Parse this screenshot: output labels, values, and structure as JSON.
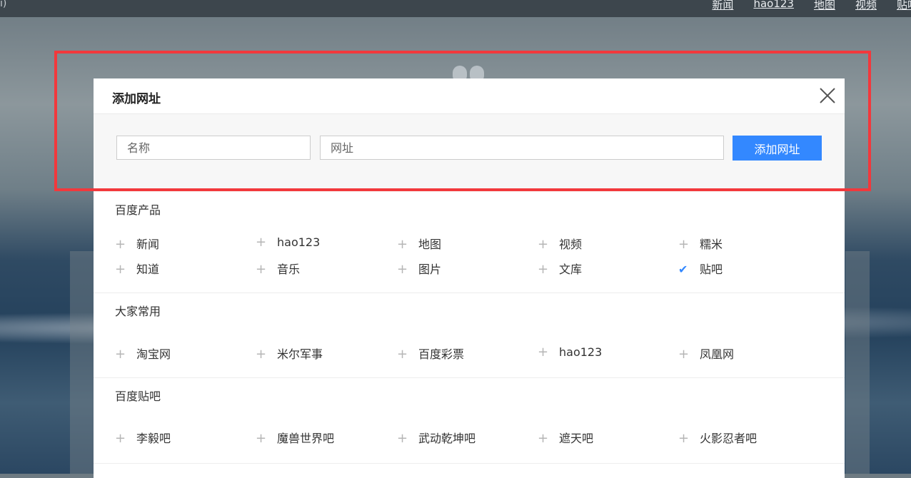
{
  "topbar": {
    "left_glyph": "ı)",
    "nav": [
      "新闻",
      "hao123",
      "地图",
      "视频",
      "贴吧"
    ]
  },
  "modal": {
    "title": "添加网址",
    "name_placeholder": "名称",
    "url_placeholder": "网址",
    "add_button": "添加网址",
    "close_icon": "close-icon"
  },
  "sections": [
    {
      "title": "百度产品",
      "items": [
        {
          "label": "新闻",
          "state": "plus"
        },
        {
          "label": "hao123",
          "state": "plus"
        },
        {
          "label": "地图",
          "state": "plus"
        },
        {
          "label": "视频",
          "state": "plus"
        },
        {
          "label": "糯米",
          "state": "plus"
        },
        {
          "label": "知道",
          "state": "plus"
        },
        {
          "label": "音乐",
          "state": "plus"
        },
        {
          "label": "图片",
          "state": "plus"
        },
        {
          "label": "文库",
          "state": "plus"
        },
        {
          "label": "贴吧",
          "state": "check"
        }
      ]
    },
    {
      "title": "大家常用",
      "items": [
        {
          "label": "淘宝网",
          "state": "plus"
        },
        {
          "label": "米尔军事",
          "state": "plus"
        },
        {
          "label": "百度彩票",
          "state": "plus"
        },
        {
          "label": "hao123",
          "state": "plus"
        },
        {
          "label": "凤凰网",
          "state": "plus"
        }
      ]
    },
    {
      "title": "百度贴吧",
      "items": [
        {
          "label": "李毅吧",
          "state": "plus"
        },
        {
          "label": "魔兽世界吧",
          "state": "plus"
        },
        {
          "label": "武动乾坤吧",
          "state": "plus"
        },
        {
          "label": "遮天吧",
          "state": "plus"
        },
        {
          "label": "火影忍者吧",
          "state": "plus"
        }
      ]
    }
  ],
  "colors": {
    "accent": "#3388ff",
    "highlight_border": "#f2383c"
  }
}
